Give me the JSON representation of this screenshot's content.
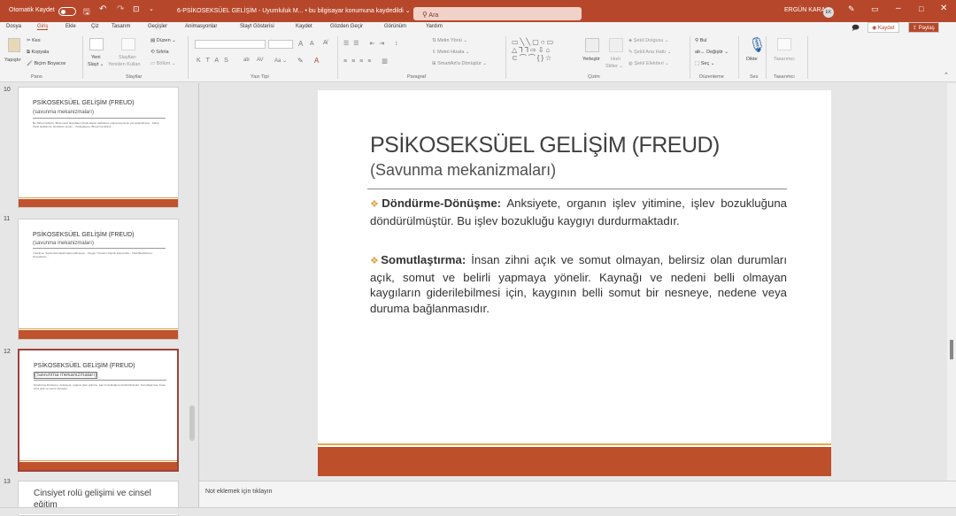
{
  "titlebar": {
    "autosave": "Otomatik Kaydet",
    "doc_title": "6-PSİKOSEKSÜEL GELİŞİM - Uyumluluk M... • bu bilgisayar konumuna kaydedildi ⌄",
    "search_placeholder": "Ara",
    "user": "ERGÜN KARA",
    "user_initials": "EK"
  },
  "tabs": [
    "Dosya",
    "Giriş",
    "Ekle",
    "Çiz",
    "Tasarım",
    "Geçişler",
    "Animasyonlar",
    "Slayt Gösterisi",
    "Kaydet",
    "Gözden Geçir",
    "Görünüm",
    "Yardım"
  ],
  "ribbon_buttons": {
    "record": "Kaydet",
    "share": "Paylaş"
  },
  "ribbon": {
    "paste": "Yapıştır",
    "cut": "Kes",
    "copy": "Kopyala",
    "format_painter": "Biçim Boyacısı",
    "new_slide": "Yeni",
    "new_slide2": "Slayt ⌄",
    "reuse_slides": "Slaytları",
    "reuse_slides2": "Yeniden Kullan",
    "layout": "Düzen ⌄",
    "reset": "Sıfırla",
    "section": "Bölüm ⌄",
    "text_direction": "Metin Yönü ⌄",
    "align_text": "Metni Hizala ⌄",
    "smartart": "SmartArt'a Dönüştür ⌄",
    "arrange": "Yerleştir",
    "quick_styles": "Hızlı",
    "quick_styles2": "Stiller ⌄",
    "shape_fill": "Şekil Dolgusu ⌄",
    "shape_outline": "Şekil Ana Hattı ⌄",
    "shape_effects": "Şekil Efektleri ⌄",
    "find": "Bul",
    "replace": "Değiştir ⌄",
    "select": "Seç ⌄",
    "dictate": "Dikte",
    "designer": "Tasarımcı",
    "groups": {
      "clipboard": "Pano",
      "slides": "Slaytlar",
      "font": "Yazı Tipi",
      "paragraph": "Paragraf",
      "drawing": "Çizim",
      "editing": "Düzenleme",
      "voice": "Ses",
      "designer": "Tasarımcı"
    }
  },
  "thumbnails": [
    {
      "num": "10",
      "title": "PSİKOSEKSÜEL GELİŞİM (FREUD)",
      "subtitle": "(savunma mekanizmaları)",
      "body": "Bu Tahmi Gidişimi: Birde karşı tıkçedideri içinde kişinin dürtülerini ortaya koyma ile yön gösterilmesi... Karşıt Tepki Geliştirme: Dürtülerin tersini... Özdeşleşme: Bireyin kendisini..."
    },
    {
      "num": "11",
      "title": "PSİKOSEKSÜEL GELİŞİM (FREUD)",
      "subtitle": "(savunma mekanizmaları)",
      "body": "Yüceltme: Toplumsal olarak kabul edilmeyen... Duygu Yönetimi: Kişinin karşısında... İnkâr(Reddetme): Gerçeklerin..."
    },
    {
      "num": "12",
      "title": "PSİKOSEKSÜEL GELİŞİM (FREUD)",
      "subtitle": "(Savunma mekanizmaları)",
      "body": "Döndürme-Dönüşme: Anksiyete, organın işlev yitimine, işlev bozukluğuna döndürülmüştür. Somutlaştırma: İnsan zihni açık ve somut olmayan..."
    },
    {
      "num": "13",
      "title": "Cinsiyet rolü gelişimi ve cinsel eğitim"
    }
  ],
  "slide": {
    "title": "PSİKOSEKSÜEL GELİŞİM (FREUD)",
    "subtitle": "(Savunma mekanizmaları)",
    "p1_head": "Döndürme-Dönüşme:",
    "p1_text": " Anksiyete, organın işlev yitimine, işlev bozukluğuna döndürülmüştür. Bu işlev bozukluğu kaygıyı durdurmaktadır.",
    "p2_head": "Somutlaştırma:",
    "p2_text": " İnsan zihni açık ve somut olmayan, belirsiz olan durumları açık, somut ve belirli yapmaya yönelir. Kaynağı ve nedeni belli olmayan kaygıların giderilebilmesi için, kaygının belli somut bir nesneye, nedene veya duruma bağlanmasıdır."
  },
  "notes_placeholder": "Not eklemek için tıklayın"
}
